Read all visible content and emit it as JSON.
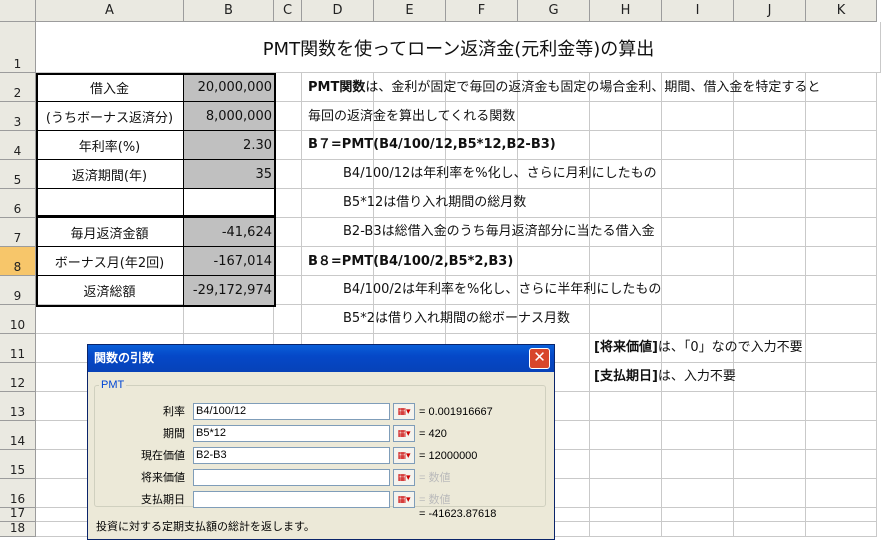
{
  "columns": [
    "A",
    "B",
    "C",
    "D",
    "E",
    "F",
    "G",
    "H",
    "I",
    "J",
    "K"
  ],
  "rows": [
    "1",
    "2",
    "3",
    "4",
    "5",
    "6",
    "7",
    "8",
    "9",
    "10",
    "11",
    "12",
    "13",
    "14",
    "15",
    "16",
    "17",
    "18"
  ],
  "selected_row": "8",
  "title": "PMT関数を使ってローン返済金(元利金等)の算出",
  "table": {
    "labels": [
      "借入金",
      "(うちボーナス返済分)",
      "年利率(%)",
      "返済期間(年)",
      "",
      "毎月返済金額",
      "ボーナス月(年2回)",
      "返済総額"
    ],
    "values": [
      "20,000,000",
      "8,000,000",
      "2.30",
      "35",
      "",
      "-41,624",
      "-167,014",
      "-29,172,974"
    ]
  },
  "notes": {
    "r2_bold": "PMT関数",
    "r2_rest": "は、金利が固定で毎回の返済金も固定の場合金利、期間、借入金を特定すると",
    "r3": "毎回の返済金を算出してくれる関数",
    "r4": "B７=PMT(B4/100/12,B5*12,B2-B3)",
    "r5": "B4/100/12は年利率を%化し、さらに月利にしたもの",
    "r6": "B5*12は借り入れ期間の総月数",
    "r7": "B2-B3は総借入金のうち毎月返済部分に当たる借入金",
    "r8": "B８=PMT(B4/100/2,B5*2,B3)",
    "r9": "B4/100/2は年利率を%化し、さらに半年利にしたもの",
    "r10": "B5*2は借り入れ期間の総ボーナス月数",
    "r11_bold": "[将来価値]",
    "r11_rest": "は、「0」なので入力不要",
    "r12_bold": "[支払期日]",
    "r12_rest": "は、入力不要"
  },
  "dialog": {
    "title": "関数の引数",
    "close": "✕",
    "group": "PMT",
    "args": [
      {
        "label": "利率",
        "value": "B4/100/12",
        "result": "= 0.001916667"
      },
      {
        "label": "期間",
        "value": "B5*12",
        "result": "= 420"
      },
      {
        "label": "現在価値",
        "value": "B2-B3",
        "result": "= 12000000"
      },
      {
        "label": "将来価値",
        "value": "",
        "result": "= 数値"
      },
      {
        "label": "支払期日",
        "value": "",
        "result": "= 数値"
      }
    ],
    "ref_icon": "collapse-ref-icon",
    "result": "= -41623.87618",
    "description": "投資に対する定期支払額の総計を返します。"
  }
}
